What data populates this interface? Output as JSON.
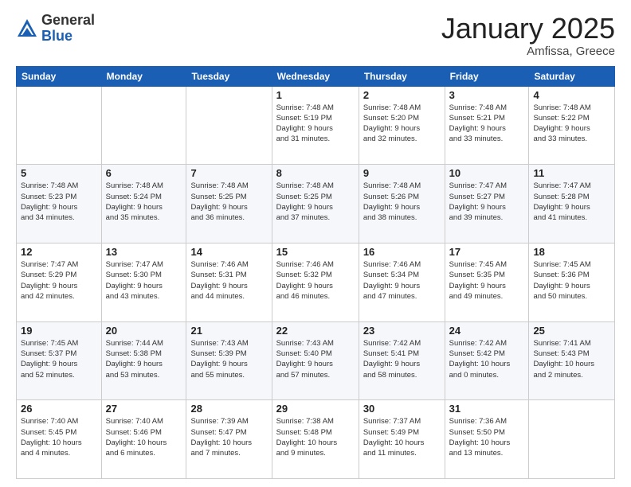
{
  "header": {
    "logo_general": "General",
    "logo_blue": "Blue",
    "month_title": "January 2025",
    "subtitle": "Amfissa, Greece"
  },
  "weekdays": [
    "Sunday",
    "Monday",
    "Tuesday",
    "Wednesday",
    "Thursday",
    "Friday",
    "Saturday"
  ],
  "weeks": [
    [
      {
        "day": "",
        "info": ""
      },
      {
        "day": "",
        "info": ""
      },
      {
        "day": "",
        "info": ""
      },
      {
        "day": "1",
        "info": "Sunrise: 7:48 AM\nSunset: 5:19 PM\nDaylight: 9 hours\nand 31 minutes."
      },
      {
        "day": "2",
        "info": "Sunrise: 7:48 AM\nSunset: 5:20 PM\nDaylight: 9 hours\nand 32 minutes."
      },
      {
        "day": "3",
        "info": "Sunrise: 7:48 AM\nSunset: 5:21 PM\nDaylight: 9 hours\nand 33 minutes."
      },
      {
        "day": "4",
        "info": "Sunrise: 7:48 AM\nSunset: 5:22 PM\nDaylight: 9 hours\nand 33 minutes."
      }
    ],
    [
      {
        "day": "5",
        "info": "Sunrise: 7:48 AM\nSunset: 5:23 PM\nDaylight: 9 hours\nand 34 minutes."
      },
      {
        "day": "6",
        "info": "Sunrise: 7:48 AM\nSunset: 5:24 PM\nDaylight: 9 hours\nand 35 minutes."
      },
      {
        "day": "7",
        "info": "Sunrise: 7:48 AM\nSunset: 5:25 PM\nDaylight: 9 hours\nand 36 minutes."
      },
      {
        "day": "8",
        "info": "Sunrise: 7:48 AM\nSunset: 5:25 PM\nDaylight: 9 hours\nand 37 minutes."
      },
      {
        "day": "9",
        "info": "Sunrise: 7:48 AM\nSunset: 5:26 PM\nDaylight: 9 hours\nand 38 minutes."
      },
      {
        "day": "10",
        "info": "Sunrise: 7:47 AM\nSunset: 5:27 PM\nDaylight: 9 hours\nand 39 minutes."
      },
      {
        "day": "11",
        "info": "Sunrise: 7:47 AM\nSunset: 5:28 PM\nDaylight: 9 hours\nand 41 minutes."
      }
    ],
    [
      {
        "day": "12",
        "info": "Sunrise: 7:47 AM\nSunset: 5:29 PM\nDaylight: 9 hours\nand 42 minutes."
      },
      {
        "day": "13",
        "info": "Sunrise: 7:47 AM\nSunset: 5:30 PM\nDaylight: 9 hours\nand 43 minutes."
      },
      {
        "day": "14",
        "info": "Sunrise: 7:46 AM\nSunset: 5:31 PM\nDaylight: 9 hours\nand 44 minutes."
      },
      {
        "day": "15",
        "info": "Sunrise: 7:46 AM\nSunset: 5:32 PM\nDaylight: 9 hours\nand 46 minutes."
      },
      {
        "day": "16",
        "info": "Sunrise: 7:46 AM\nSunset: 5:34 PM\nDaylight: 9 hours\nand 47 minutes."
      },
      {
        "day": "17",
        "info": "Sunrise: 7:45 AM\nSunset: 5:35 PM\nDaylight: 9 hours\nand 49 minutes."
      },
      {
        "day": "18",
        "info": "Sunrise: 7:45 AM\nSunset: 5:36 PM\nDaylight: 9 hours\nand 50 minutes."
      }
    ],
    [
      {
        "day": "19",
        "info": "Sunrise: 7:45 AM\nSunset: 5:37 PM\nDaylight: 9 hours\nand 52 minutes."
      },
      {
        "day": "20",
        "info": "Sunrise: 7:44 AM\nSunset: 5:38 PM\nDaylight: 9 hours\nand 53 minutes."
      },
      {
        "day": "21",
        "info": "Sunrise: 7:43 AM\nSunset: 5:39 PM\nDaylight: 9 hours\nand 55 minutes."
      },
      {
        "day": "22",
        "info": "Sunrise: 7:43 AM\nSunset: 5:40 PM\nDaylight: 9 hours\nand 57 minutes."
      },
      {
        "day": "23",
        "info": "Sunrise: 7:42 AM\nSunset: 5:41 PM\nDaylight: 9 hours\nand 58 minutes."
      },
      {
        "day": "24",
        "info": "Sunrise: 7:42 AM\nSunset: 5:42 PM\nDaylight: 10 hours\nand 0 minutes."
      },
      {
        "day": "25",
        "info": "Sunrise: 7:41 AM\nSunset: 5:43 PM\nDaylight: 10 hours\nand 2 minutes."
      }
    ],
    [
      {
        "day": "26",
        "info": "Sunrise: 7:40 AM\nSunset: 5:45 PM\nDaylight: 10 hours\nand 4 minutes."
      },
      {
        "day": "27",
        "info": "Sunrise: 7:40 AM\nSunset: 5:46 PM\nDaylight: 10 hours\nand 6 minutes."
      },
      {
        "day": "28",
        "info": "Sunrise: 7:39 AM\nSunset: 5:47 PM\nDaylight: 10 hours\nand 7 minutes."
      },
      {
        "day": "29",
        "info": "Sunrise: 7:38 AM\nSunset: 5:48 PM\nDaylight: 10 hours\nand 9 minutes."
      },
      {
        "day": "30",
        "info": "Sunrise: 7:37 AM\nSunset: 5:49 PM\nDaylight: 10 hours\nand 11 minutes."
      },
      {
        "day": "31",
        "info": "Sunrise: 7:36 AM\nSunset: 5:50 PM\nDaylight: 10 hours\nand 13 minutes."
      },
      {
        "day": "",
        "info": ""
      }
    ]
  ]
}
